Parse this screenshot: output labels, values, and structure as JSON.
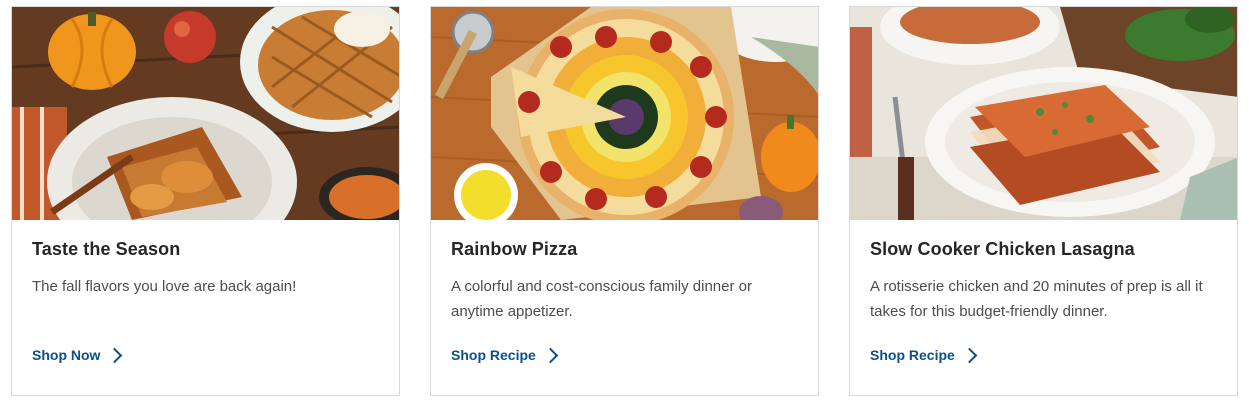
{
  "cards": [
    {
      "title": "Taste the Season",
      "description": "The fall flavors you love are back again!",
      "cta_label": "Shop Now",
      "cta_icon": "chevron-right-icon",
      "image": "fall-breakfast-photo"
    },
    {
      "title": "Rainbow Pizza",
      "description": "A colorful and cost-conscious family dinner or anytime appetizer.",
      "cta_label": "Shop Recipe",
      "cta_icon": "chevron-right-icon",
      "image": "rainbow-pizza-photo"
    },
    {
      "title": "Slow Cooker Chicken Lasagna",
      "description": "A rotisserie chicken and 20 minutes of prep is all it takes for this budget-friendly dinner.",
      "cta_label": "Shop Recipe",
      "cta_icon": "chevron-right-icon",
      "image": "lasagna-photo"
    }
  ],
  "colors": {
    "link": "#0e4f8b",
    "title": "#262626",
    "body_text": "#4d4d4d",
    "card_border": "#d9d9d9"
  }
}
